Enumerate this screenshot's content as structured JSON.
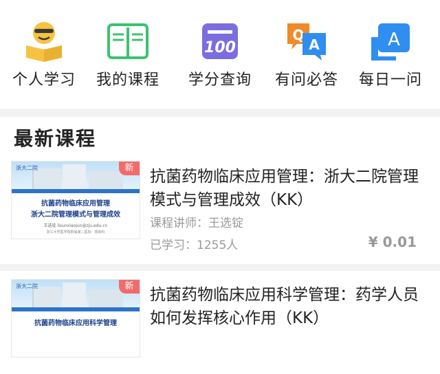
{
  "nav": {
    "items": [
      {
        "label": "个人学习",
        "icon": "reading-person-icon"
      },
      {
        "label": "我的课程",
        "icon": "open-book-icon"
      },
      {
        "label": "学分查询",
        "icon": "score-100-icon"
      },
      {
        "label": "有问必答",
        "icon": "qa-bubbles-icon"
      },
      {
        "label": "每日一问",
        "icon": "daily-question-icon"
      }
    ]
  },
  "section": {
    "title": "最新课程"
  },
  "courses": [
    {
      "tag": "新",
      "title": "抗菌药物临床应用管理：浙大二院管理模式与管理成效（KK）",
      "teacher": "课程讲师：王选锭",
      "learned": "已学习：1255人",
      "price": "¥ 0.01",
      "thumb": {
        "hospital": "浙大二院",
        "line1": "抗菌药物临床应用管理",
        "line2": "浙大二院管理模式与管理成效",
        "line3": "王选锭 lisunxiaojun@zju.edu.cn",
        "line4": "浙江大学医学院附属第二医院 · 感染科"
      }
    },
    {
      "tag": "新",
      "title": "抗菌药物临床应用科学管理：药学人员如何发挥核心作用（KK）",
      "teacher": "",
      "learned": "",
      "price": "",
      "thumb": {
        "hospital": "浙大二院",
        "line1": "抗菌药物临床应用科学管理",
        "line2": "",
        "line3": "",
        "line4": ""
      }
    }
  ],
  "colors": {
    "accent_yellow": "#f6c341",
    "accent_green": "#3cc26e",
    "accent_purple": "#7b6de0",
    "accent_orange": "#f08a2b",
    "accent_blue": "#2f8ef0",
    "new_tag": "#f26b6b"
  }
}
